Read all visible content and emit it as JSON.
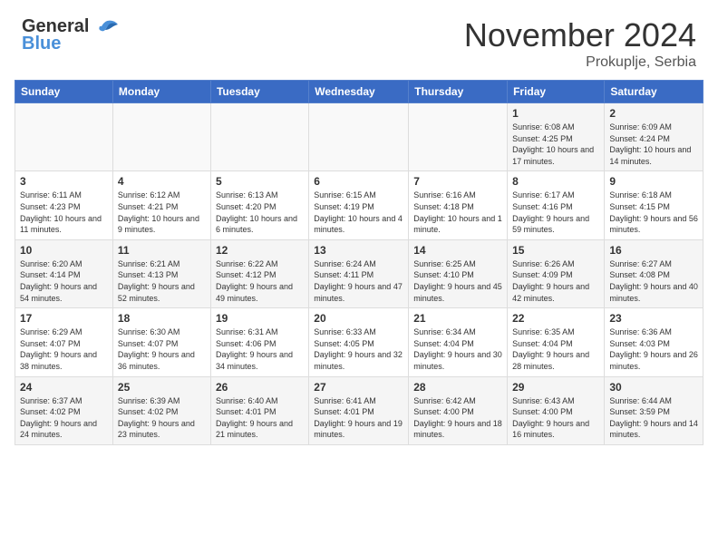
{
  "header": {
    "logo_text_general": "General",
    "logo_text_blue": "Blue",
    "month_title": "November 2024",
    "location": "Prokuplje, Serbia"
  },
  "calendar": {
    "days_of_week": [
      "Sunday",
      "Monday",
      "Tuesday",
      "Wednesday",
      "Thursday",
      "Friday",
      "Saturday"
    ],
    "weeks": [
      [
        {
          "day": "",
          "info": ""
        },
        {
          "day": "",
          "info": ""
        },
        {
          "day": "",
          "info": ""
        },
        {
          "day": "",
          "info": ""
        },
        {
          "day": "",
          "info": ""
        },
        {
          "day": "1",
          "info": "Sunrise: 6:08 AM\nSunset: 4:25 PM\nDaylight: 10 hours and 17 minutes."
        },
        {
          "day": "2",
          "info": "Sunrise: 6:09 AM\nSunset: 4:24 PM\nDaylight: 10 hours and 14 minutes."
        }
      ],
      [
        {
          "day": "3",
          "info": "Sunrise: 6:11 AM\nSunset: 4:23 PM\nDaylight: 10 hours and 11 minutes."
        },
        {
          "day": "4",
          "info": "Sunrise: 6:12 AM\nSunset: 4:21 PM\nDaylight: 10 hours and 9 minutes."
        },
        {
          "day": "5",
          "info": "Sunrise: 6:13 AM\nSunset: 4:20 PM\nDaylight: 10 hours and 6 minutes."
        },
        {
          "day": "6",
          "info": "Sunrise: 6:15 AM\nSunset: 4:19 PM\nDaylight: 10 hours and 4 minutes."
        },
        {
          "day": "7",
          "info": "Sunrise: 6:16 AM\nSunset: 4:18 PM\nDaylight: 10 hours and 1 minute."
        },
        {
          "day": "8",
          "info": "Sunrise: 6:17 AM\nSunset: 4:16 PM\nDaylight: 9 hours and 59 minutes."
        },
        {
          "day": "9",
          "info": "Sunrise: 6:18 AM\nSunset: 4:15 PM\nDaylight: 9 hours and 56 minutes."
        }
      ],
      [
        {
          "day": "10",
          "info": "Sunrise: 6:20 AM\nSunset: 4:14 PM\nDaylight: 9 hours and 54 minutes."
        },
        {
          "day": "11",
          "info": "Sunrise: 6:21 AM\nSunset: 4:13 PM\nDaylight: 9 hours and 52 minutes."
        },
        {
          "day": "12",
          "info": "Sunrise: 6:22 AM\nSunset: 4:12 PM\nDaylight: 9 hours and 49 minutes."
        },
        {
          "day": "13",
          "info": "Sunrise: 6:24 AM\nSunset: 4:11 PM\nDaylight: 9 hours and 47 minutes."
        },
        {
          "day": "14",
          "info": "Sunrise: 6:25 AM\nSunset: 4:10 PM\nDaylight: 9 hours and 45 minutes."
        },
        {
          "day": "15",
          "info": "Sunrise: 6:26 AM\nSunset: 4:09 PM\nDaylight: 9 hours and 42 minutes."
        },
        {
          "day": "16",
          "info": "Sunrise: 6:27 AM\nSunset: 4:08 PM\nDaylight: 9 hours and 40 minutes."
        }
      ],
      [
        {
          "day": "17",
          "info": "Sunrise: 6:29 AM\nSunset: 4:07 PM\nDaylight: 9 hours and 38 minutes."
        },
        {
          "day": "18",
          "info": "Sunrise: 6:30 AM\nSunset: 4:07 PM\nDaylight: 9 hours and 36 minutes."
        },
        {
          "day": "19",
          "info": "Sunrise: 6:31 AM\nSunset: 4:06 PM\nDaylight: 9 hours and 34 minutes."
        },
        {
          "day": "20",
          "info": "Sunrise: 6:33 AM\nSunset: 4:05 PM\nDaylight: 9 hours and 32 minutes."
        },
        {
          "day": "21",
          "info": "Sunrise: 6:34 AM\nSunset: 4:04 PM\nDaylight: 9 hours and 30 minutes."
        },
        {
          "day": "22",
          "info": "Sunrise: 6:35 AM\nSunset: 4:04 PM\nDaylight: 9 hours and 28 minutes."
        },
        {
          "day": "23",
          "info": "Sunrise: 6:36 AM\nSunset: 4:03 PM\nDaylight: 9 hours and 26 minutes."
        }
      ],
      [
        {
          "day": "24",
          "info": "Sunrise: 6:37 AM\nSunset: 4:02 PM\nDaylight: 9 hours and 24 minutes."
        },
        {
          "day": "25",
          "info": "Sunrise: 6:39 AM\nSunset: 4:02 PM\nDaylight: 9 hours and 23 minutes."
        },
        {
          "day": "26",
          "info": "Sunrise: 6:40 AM\nSunset: 4:01 PM\nDaylight: 9 hours and 21 minutes."
        },
        {
          "day": "27",
          "info": "Sunrise: 6:41 AM\nSunset: 4:01 PM\nDaylight: 9 hours and 19 minutes."
        },
        {
          "day": "28",
          "info": "Sunrise: 6:42 AM\nSunset: 4:00 PM\nDaylight: 9 hours and 18 minutes."
        },
        {
          "day": "29",
          "info": "Sunrise: 6:43 AM\nSunset: 4:00 PM\nDaylight: 9 hours and 16 minutes."
        },
        {
          "day": "30",
          "info": "Sunrise: 6:44 AM\nSunset: 3:59 PM\nDaylight: 9 hours and 14 minutes."
        }
      ]
    ]
  },
  "colors": {
    "header_bg": "#3a6bc4",
    "header_text": "#ffffff",
    "odd_row": "#f5f5f5",
    "even_row": "#ffffff"
  }
}
